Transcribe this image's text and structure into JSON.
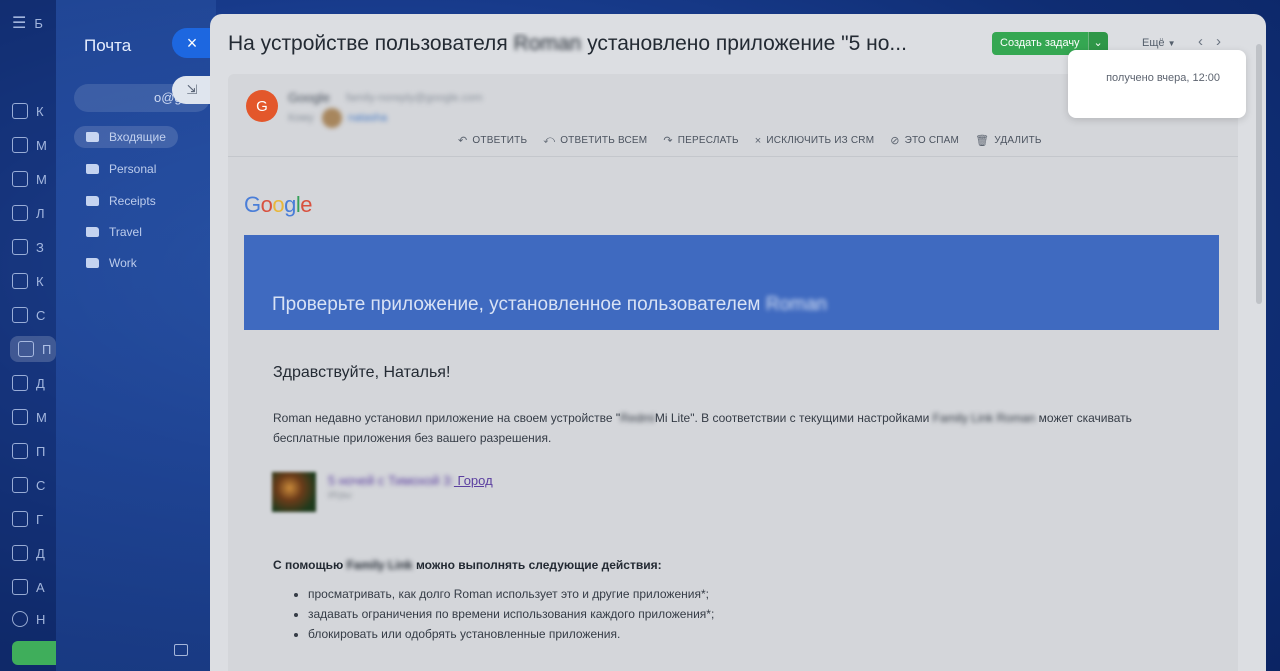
{
  "sidebar": {
    "items": [
      {
        "label": "К"
      },
      {
        "label": "М"
      },
      {
        "label": "М"
      },
      {
        "label": "Л"
      },
      {
        "label": "З"
      },
      {
        "label": "К"
      },
      {
        "label": "С"
      },
      {
        "label": "П"
      },
      {
        "label": "Д"
      },
      {
        "label": "М"
      },
      {
        "label": "П"
      },
      {
        "label": "С"
      },
      {
        "label": "Г"
      },
      {
        "label": "Д"
      },
      {
        "label": "А"
      },
      {
        "label": "Н"
      }
    ],
    "top_label": "Б"
  },
  "mail": {
    "title": "Почта",
    "close_glyph": "×",
    "account": "o@gm",
    "account_btn_glyph": "⇲",
    "folders": [
      {
        "label": "Входящие"
      },
      {
        "label": "Personal"
      },
      {
        "label": "Receipts"
      },
      {
        "label": "Travel"
      },
      {
        "label": "Work"
      }
    ]
  },
  "email": {
    "subject_prefix": "На устройстве пользователя",
    "subject_blurred": "Roman",
    "subject_suffix": "установлено приложение \"5 но...",
    "create_task": "Создать задачу",
    "more": "Ещё",
    "nav_prev": "‹",
    "nav_next": "›",
    "sender_initial": "G",
    "sender_name": "Google",
    "sender_email": "family-noreply@google.com",
    "to_label": "Кому",
    "to_name": "natasha",
    "actions": [
      {
        "icon": "↶",
        "label": "ОТВЕТИТЬ"
      },
      {
        "icon": "⤺",
        "label": "ОТВЕТИТЬ ВСЕМ"
      },
      {
        "icon": "↷",
        "label": "ПЕРЕСЛАТЬ"
      },
      {
        "icon": "×",
        "label": "ИСКЛЮЧИТЬ ИЗ CRM"
      },
      {
        "icon": "⊘",
        "label": "ЭТО СПАМ"
      },
      {
        "icon": "🗑",
        "label": "УДАЛИТЬ"
      }
    ],
    "banner_text": "Проверьте приложение, установленное пользователем",
    "banner_blurred": "Roman",
    "greeting": "Здравствуйте, Наталья!",
    "para1_a": "Roman недавно установил приложение на своем устройстве \"",
    "para1_b": "Mi Lite\". В соответствии с текущими настройками",
    "para1_c": "Family Link Roman",
    "para1_d": "может скачивать бесплатные приложения без вашего разрешения.",
    "app_link_blurred": "5 ночей с Тимохой 3:",
    "app_link": "Город",
    "app_sub": "Игры",
    "can_prefix": "С помощью",
    "can_blurred": "Family Link",
    "can_suffix": "можно выполнять следующие действия:",
    "list_items": [
      "просматривать, как долго Roman использует это и другие приложения*;",
      "задавать ограничения по времени использования каждого приложения*;",
      "блокировать или одобрять установленные приложения."
    ]
  },
  "tooltip": {
    "text": "получено вчера, 12:00"
  }
}
